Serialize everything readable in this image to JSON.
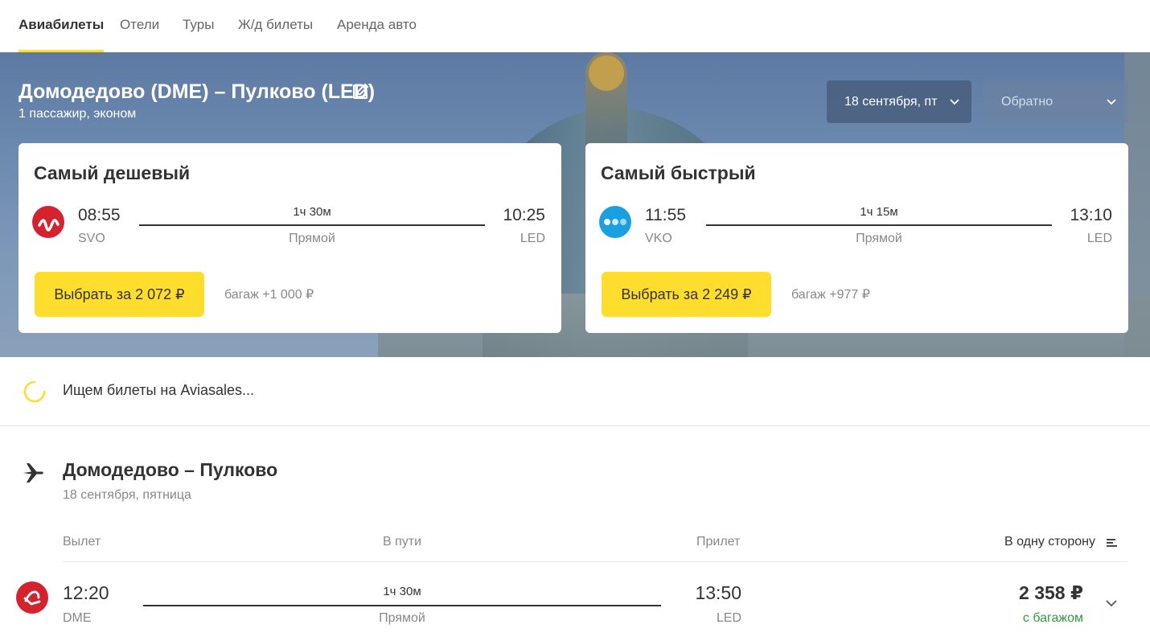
{
  "nav": {
    "tabs": [
      {
        "label": "Авиабилеты",
        "active": true
      },
      {
        "label": "Отели"
      },
      {
        "label": "Туры"
      },
      {
        "label": "Ж/д билеты"
      },
      {
        "label": "Аренда авто"
      }
    ]
  },
  "hero": {
    "route_title": "Домодедово (DME) – Пулково (LED)",
    "subtitle": "1 пассажир, эконом",
    "date_there": "18 сентября, пт",
    "date_back": "Обратно"
  },
  "cards": {
    "cheapest": {
      "title": "Самый дешевый",
      "airline_icon": "s7-airline-logo",
      "dep_time": "08:55",
      "dep_code": "SVO",
      "duration": "1ч 30м",
      "stops": "Прямой",
      "arr_time": "10:25",
      "arr_code": "LED",
      "button": "Выбрать за 2 072 ₽",
      "baggage": "багаж +1 000 ₽"
    },
    "fastest": {
      "title": "Самый быстрый",
      "airline_icon": "pobeda-airline-logo",
      "dep_time": "11:55",
      "dep_code": "VKO",
      "duration": "1ч 15м",
      "stops": "Прямой",
      "arr_time": "13:10",
      "arr_code": "LED",
      "button": "Выбрать за 2 249 ₽",
      "baggage": "багаж +977 ₽"
    }
  },
  "status": {
    "text": "Ищем билеты на Aviasales..."
  },
  "results": {
    "title": "Домодедово – Пулково",
    "date": "18 сентября, пятница",
    "headers": {
      "dep": "Вылет",
      "dur": "В пути",
      "arr": "Прилет",
      "sort": "В одну сторону"
    },
    "rows": [
      {
        "airline_icon": "s7-airline-logo",
        "dep_time": "12:20",
        "dep_code": "DME",
        "duration": "1ч 30м",
        "stops": "Прямой",
        "arr_time": "13:50",
        "arr_code": "LED",
        "price": "2 358 ₽",
        "baggage": "с багажом"
      }
    ]
  },
  "colors": {
    "accent": "#ffdd2d",
    "s7": "#d4232f",
    "pobeda": "#1aa0e0",
    "baggage_ok": "#2d9d3b"
  }
}
